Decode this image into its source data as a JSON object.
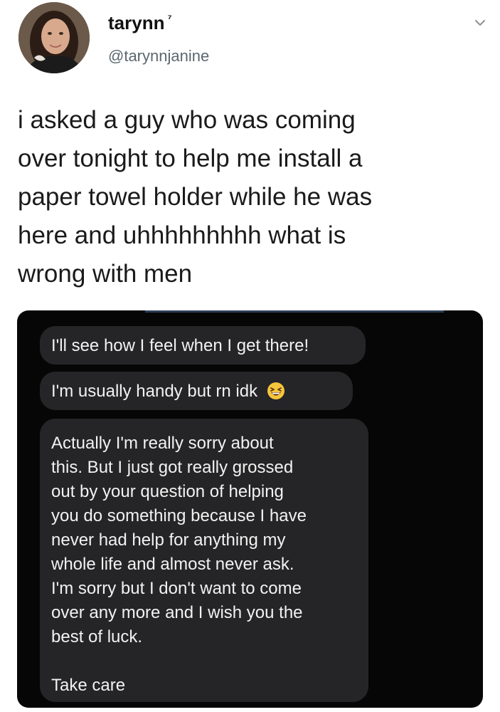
{
  "header": {
    "display_name": "tarynn",
    "display_name_mark": "⁷",
    "handle": "@tarynnjanine"
  },
  "tweet": {
    "lines": [
      "i asked a guy who was coming",
      "over tonight to help me install a",
      "paper towel holder while he was",
      "here and uhhhhhhhhh what is",
      "wrong with men"
    ]
  },
  "messages": {
    "bubble_1": "I'll see how I feel when I get there!",
    "bubble_2": "I'm usually handy but rn idk",
    "bubble_2_icon": "grinning-squinting-emoji",
    "bubble_3_lines": [
      "Actually I'm really sorry about",
      "this. But I just got really grossed",
      "out by your question of helping",
      "you do something because I have",
      "never had help for anything my",
      "whole life and almost never ask.",
      "I'm sorry but I don't want to come",
      "over any more and I wish you the",
      "best of luck."
    ],
    "bubble_3_signoff": "Take care"
  },
  "icons": {
    "menu": "chevron-down-icon"
  },
  "colors": {
    "text": "#111111",
    "handle": "#5b6770",
    "screenshot_bg": "#060606",
    "bubble_bg": "#252527",
    "bubble_text": "#f2f2f2"
  }
}
